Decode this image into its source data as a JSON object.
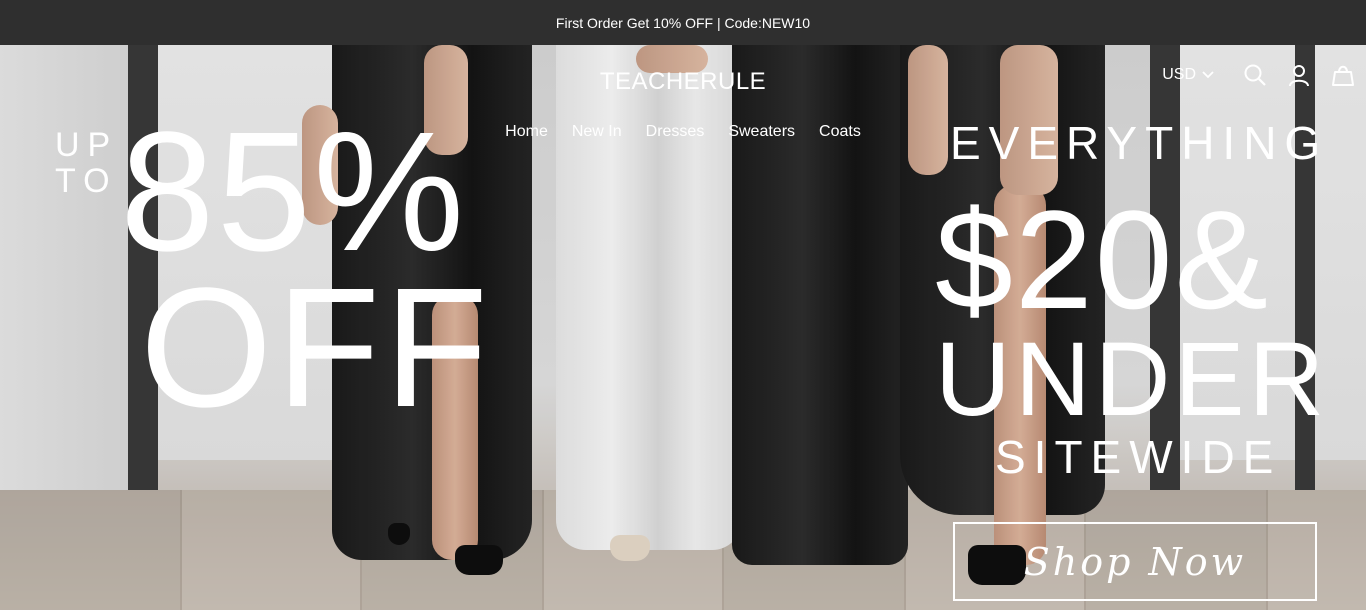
{
  "announcement": {
    "text": "First Order Get 10% OFF | Code:NEW10"
  },
  "header": {
    "brand": "TEACHERULE",
    "currency": "USD",
    "icons": [
      "search-icon",
      "account-icon",
      "cart-icon"
    ]
  },
  "nav": {
    "items": [
      {
        "label": "Home"
      },
      {
        "label": "New In"
      },
      {
        "label": "Dresses"
      },
      {
        "label": "Sweaters"
      },
      {
        "label": "Coats"
      }
    ]
  },
  "hero": {
    "left": {
      "up": "UP",
      "to": "TO",
      "percent": "85%",
      "off": "OFF"
    },
    "right": {
      "everything": "EVERYTHING",
      "price": "$20&",
      "under": "UNDER",
      "sitewide": "SITEWIDE"
    },
    "cta_label": "Shop Now"
  },
  "colors": {
    "announcement_bg": "#2f2f2f",
    "text": "#ffffff"
  }
}
